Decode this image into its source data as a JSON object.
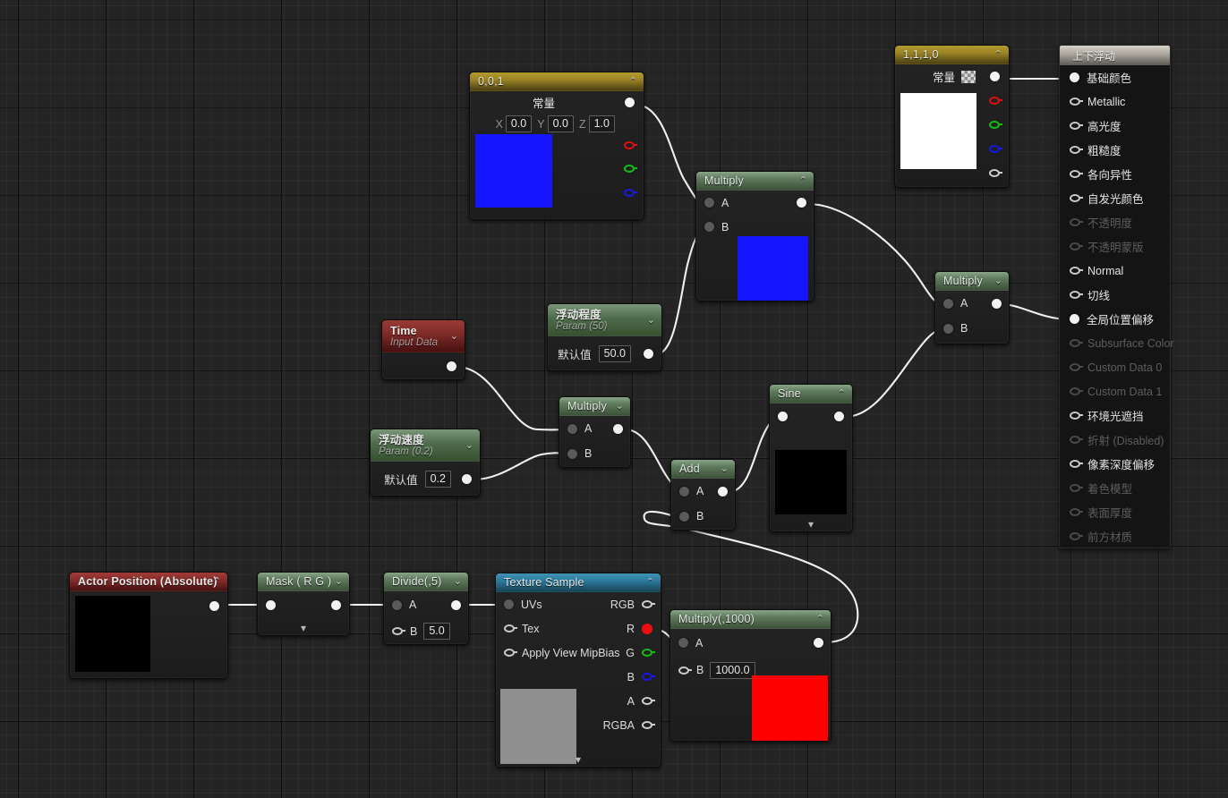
{
  "app": {
    "kind": "material-graph-editor",
    "background_color": "#242424"
  },
  "material_output": {
    "title": "上下浮动",
    "pins": [
      {
        "label": "基础颜色",
        "state": "connected"
      },
      {
        "label": "Metallic",
        "state": "enabled"
      },
      {
        "label": "高光度",
        "state": "enabled"
      },
      {
        "label": "粗糙度",
        "state": "enabled"
      },
      {
        "label": "各向异性",
        "state": "enabled"
      },
      {
        "label": "自发光颜色",
        "state": "enabled"
      },
      {
        "label": "不透明度",
        "state": "disabled"
      },
      {
        "label": "不透明蒙版",
        "state": "disabled"
      },
      {
        "label": "Normal",
        "state": "enabled"
      },
      {
        "label": "切线",
        "state": "enabled"
      },
      {
        "label": "全局位置偏移",
        "state": "connected"
      },
      {
        "label": "Subsurface Color",
        "state": "disabled"
      },
      {
        "label": "Custom Data 0",
        "state": "disabled"
      },
      {
        "label": "Custom Data 1",
        "state": "disabled"
      },
      {
        "label": "环境光遮挡",
        "state": "enabled"
      },
      {
        "label": "折射 (Disabled)",
        "state": "disabled"
      },
      {
        "label": "像素深度偏移",
        "state": "enabled"
      },
      {
        "label": "着色模型",
        "state": "disabled"
      },
      {
        "label": "表面厚度",
        "state": "disabled"
      },
      {
        "label": "前方材质",
        "state": "disabled"
      }
    ]
  },
  "nodes": {
    "const_1110": {
      "title": "1,1,1,0",
      "constant_label": "常量",
      "swatch_color": "#ffffff",
      "outputs": [
        "",
        "R",
        "G",
        "B",
        "A"
      ]
    },
    "const_001": {
      "title": "0,0,1",
      "constant_label": "常量",
      "axis_x_label": "X",
      "axis_x_value": "0.0",
      "axis_y_label": "Y",
      "axis_y_value": "0.0",
      "axis_z_label": "Z",
      "axis_z_value": "1.0",
      "swatch_color": "#1515ff"
    },
    "multiply_top": {
      "title": "Multiply",
      "input_a": "A",
      "input_b": "B",
      "swatch_color": "#1515ff"
    },
    "multiply_right": {
      "title": "Multiply",
      "input_a": "A",
      "input_b": "B"
    },
    "time_node": {
      "title": "Time",
      "subtitle": "Input Data"
    },
    "param_amount": {
      "title": "浮动程度",
      "subtitle": "Param (50)",
      "default_label": "默认值",
      "default_value": "50.0"
    },
    "param_speed": {
      "title": "浮动速度",
      "subtitle": "Param (0.2)",
      "default_label": "默认值",
      "default_value": "0.2"
    },
    "multiply_mid": {
      "title": "Multiply",
      "input_a": "A",
      "input_b": "B"
    },
    "add_node": {
      "title": "Add",
      "input_a": "A",
      "input_b": "B"
    },
    "sine_node": {
      "title": "Sine",
      "swatch_color": "#000000"
    },
    "actor_position": {
      "title": "Actor Position (Absolute)",
      "swatch_color": "#000000"
    },
    "mask_rg": {
      "title": "Mask ( R G )"
    },
    "divide_5": {
      "title": "Divide(,5)",
      "input_a": "A",
      "input_b": "B",
      "b_value": "5.0"
    },
    "texture_sample": {
      "title": "Texture Sample",
      "inputs": [
        "UVs",
        "Tex",
        "Apply View MipBias"
      ],
      "outputs": [
        "RGB",
        "R",
        "G",
        "B",
        "A",
        "RGBA"
      ],
      "swatch_color": "#8f8f8f"
    },
    "multiply_1000": {
      "title": "Multiply(,1000)",
      "input_a": "A",
      "input_b": "B",
      "b_value": "1000.0",
      "swatch_color": "#ff0000"
    }
  },
  "colors": {
    "wire": "#f0f0f0",
    "header_green": "#5e7a5c",
    "header_gold": "#9c8426",
    "header_red": "#7d2b28",
    "header_blue": "#2b7799",
    "pin_red": "#ee0e0e",
    "pin_green": "#10c010",
    "pin_blue": "#1818e8"
  }
}
